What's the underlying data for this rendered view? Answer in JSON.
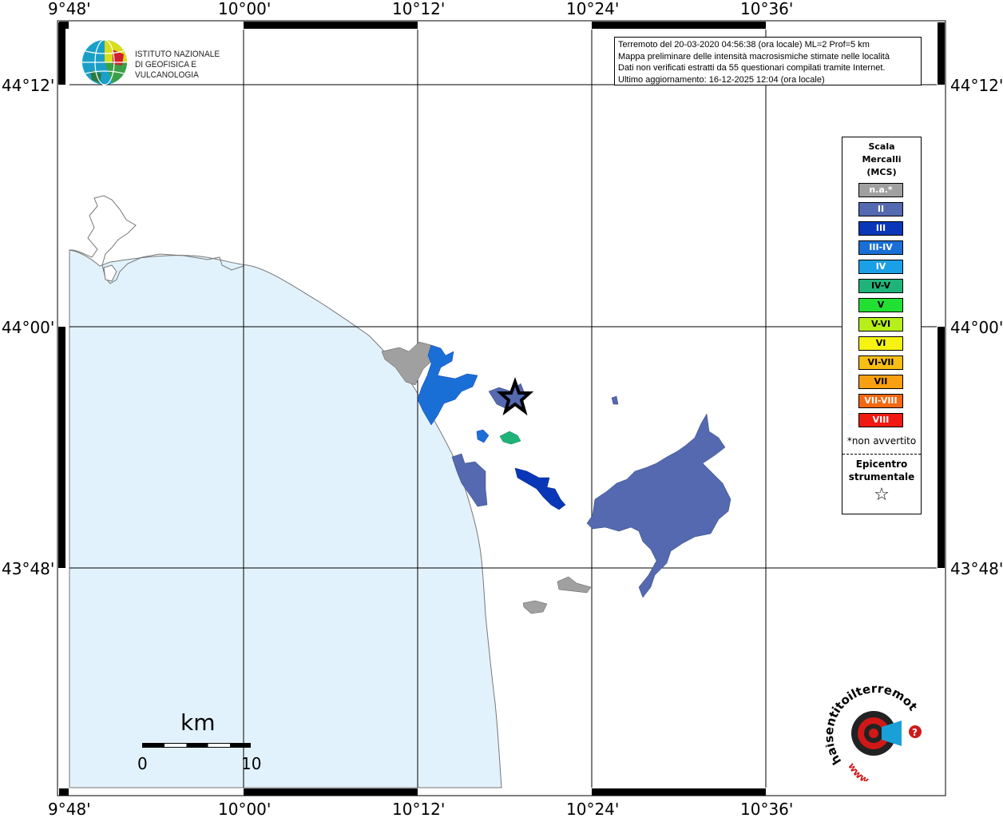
{
  "map": {
    "lon_ticks": [
      "9°48'",
      "10°00'",
      "10°12'",
      "10°24'",
      "10°36'"
    ],
    "lat_ticks": [
      "44°12'",
      "44°00'",
      "43°48'"
    ],
    "colors": {
      "sea": "#e2f2fc",
      "land": "#ffffff",
      "grid": "#000000",
      "coast": "#777777"
    },
    "epicenter": {
      "symbol": "star-icon"
    }
  },
  "info": {
    "line1": "Terremoto del 20-03-2020 04:56:38 (ora locale) ML=2 Prof=5 km",
    "line2": "Mappa preliminare delle intensità macrosismiche stimate nelle località",
    "line3": "Dati non verificati estratti da 55 questionari compilati tramite Internet.",
    "line4": "Ultimo aggiornamento: 16-12-2025 12:04 (ora locale)"
  },
  "ingv": {
    "line1": "ISTITUTO NAZIONALE",
    "line2": "DI GEOFISICA E VULCANOLOGIA"
  },
  "legend": {
    "title1": "Scala",
    "title2": "Mercalli",
    "title3": "(MCS)",
    "items": [
      {
        "label": "n.a.*",
        "color": "#a0a0a0"
      },
      {
        "label": "II",
        "color": "#5469b0"
      },
      {
        "label": "III",
        "color": "#0a37b8"
      },
      {
        "label": "III-IV",
        "color": "#1a6fd6"
      },
      {
        "label": "IV",
        "color": "#1aa0e6"
      },
      {
        "label": "IV-V",
        "color": "#1fb37a"
      },
      {
        "label": "V",
        "color": "#22e032"
      },
      {
        "label": "V-VI",
        "color": "#b6ef1a"
      },
      {
        "label": "VI",
        "color": "#f6f212"
      },
      {
        "label": "VI-VII",
        "color": "#f8be14"
      },
      {
        "label": "VII",
        "color": "#f8a012"
      },
      {
        "label": "VII-VIII",
        "color": "#f56812"
      },
      {
        "label": "VIII",
        "color": "#f01a12"
      }
    ],
    "note": "*non avvertito",
    "epi1": "Epicentro",
    "epi2": "strumentale",
    "star": "☆"
  },
  "scalebar": {
    "unit": "km",
    "min": "0",
    "max": "10"
  },
  "hst": {
    "text": "haisentitoilterremoto.it",
    "www": "www."
  }
}
